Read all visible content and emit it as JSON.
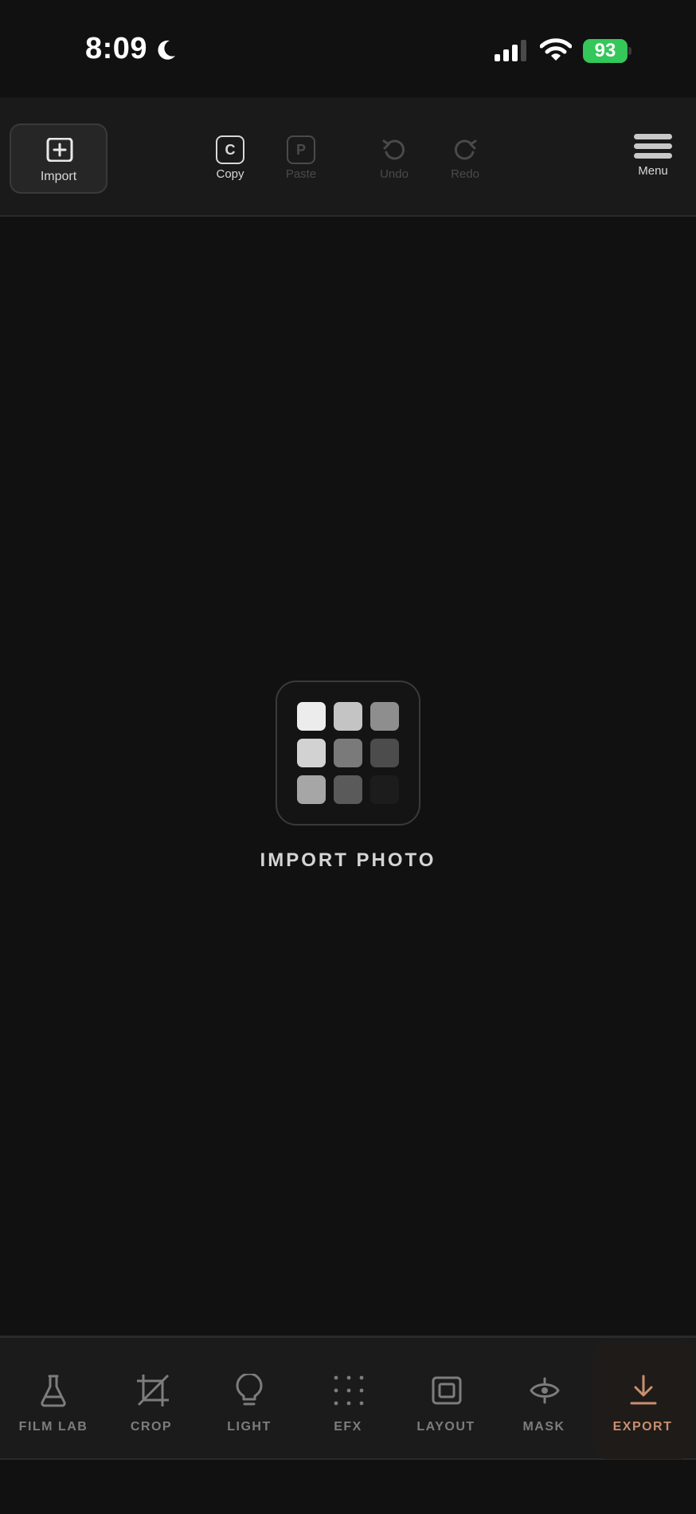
{
  "status_bar": {
    "time": "8:09",
    "battery": "93",
    "icons": [
      "moon-icon",
      "signal-icon",
      "wifi-icon",
      "battery-charging-icon"
    ]
  },
  "toolbar": {
    "import_label": "Import",
    "copy_key": "C",
    "copy_label": "Copy",
    "paste_key": "P",
    "paste_label": "Paste",
    "undo_label": "Undo",
    "redo_label": "Redo",
    "menu_label": "Menu"
  },
  "canvas": {
    "import_photo_label": "IMPORT PHOTO",
    "swatch_colors": [
      "#ececec",
      "#c4c4c4",
      "#8e8e8e",
      "#d2d2d2",
      "#7a7a7a",
      "#4c4c4c",
      "#a6a6a6",
      "#5a5a5a",
      "#1c1c1c"
    ]
  },
  "bottom_nav": {
    "items": [
      {
        "label": "FILM LAB",
        "icon": "flask-icon"
      },
      {
        "label": "CROP",
        "icon": "crop-icon"
      },
      {
        "label": "LIGHT",
        "icon": "lightbulb-icon"
      },
      {
        "label": "EFX",
        "icon": "dots-grid-icon"
      },
      {
        "label": "LAYOUT",
        "icon": "frame-icon"
      },
      {
        "label": "MASK",
        "icon": "eye-mask-icon"
      },
      {
        "label": "EXPORT",
        "icon": "download-icon"
      }
    ],
    "active": "EXPORT",
    "accent_color": "#c98f6f"
  }
}
